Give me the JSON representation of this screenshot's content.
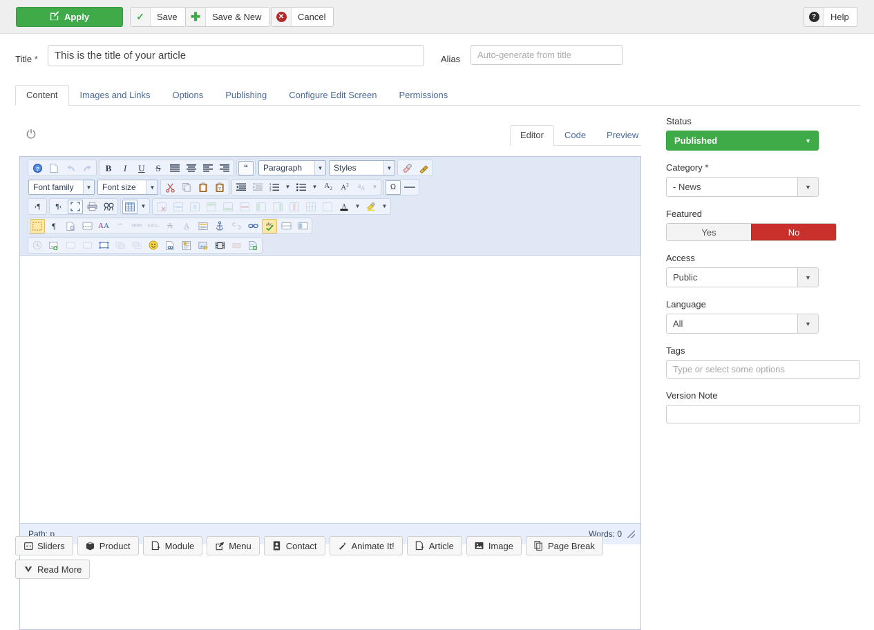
{
  "toolbar": {
    "apply_label": "Apply",
    "apply_icon": "edit-square-icon",
    "save_label": "Save",
    "save_icon": "check-icon",
    "save_new_label": "Save & New",
    "save_new_icon": "plus-icon",
    "cancel_label": "Cancel",
    "cancel_icon": "circle-x-icon",
    "help_label": "Help",
    "help_icon": "circle-question-icon"
  },
  "form": {
    "title_label": "Title",
    "title_required": "*",
    "title_value": "This is the title of your article",
    "alias_label": "Alias",
    "alias_value": "",
    "alias_placeholder": "Auto-generate from title"
  },
  "tabs": [
    {
      "label": "Content",
      "active": true
    },
    {
      "label": "Images and Links",
      "active": false
    },
    {
      "label": "Options",
      "active": false
    },
    {
      "label": "Publishing",
      "active": false
    },
    {
      "label": "Configure Edit Screen",
      "active": false
    },
    {
      "label": "Permissions",
      "active": false
    }
  ],
  "editor": {
    "toggle_icon": "power-icon",
    "view_tabs": [
      {
        "label": "Editor",
        "active": true
      },
      {
        "label": "Code",
        "active": false
      },
      {
        "label": "Preview",
        "active": false
      }
    ],
    "content": "",
    "status_path_label": "Path:",
    "status_path_value": "p",
    "status_words_label": "Words:",
    "status_words_value": "0",
    "selects": {
      "paragraph": "Paragraph",
      "styles": "Styles",
      "font_family": "Font family",
      "font_size": "Font size"
    },
    "row1_icons": [
      "help-icon",
      "new-document-icon",
      "undo-icon",
      "redo-icon",
      "bold-icon",
      "italic-icon",
      "underline-icon",
      "strikethrough-icon",
      "align-justify-icon",
      "align-center-icon",
      "align-left-icon",
      "align-right-icon",
      "blockquote-icon",
      "eraser-icon",
      "cleanup-icon"
    ],
    "row2_icons": [
      "cut-icon",
      "copy-icon",
      "paste-icon",
      "paste-text-icon",
      "outdent-icon",
      "indent-icon",
      "numbered-list-icon",
      "numbered-list-dropdown-icon",
      "bullet-list-icon",
      "bullet-list-dropdown-icon",
      "subscript-icon",
      "superscript-icon",
      "remove-format-icon",
      "special-character-icon",
      "horizontal-rule-icon"
    ],
    "row3_icons": [
      "ltr-icon",
      "rtl-icon",
      "fullscreen-icon",
      "print-icon",
      "search-replace-icon",
      "table-icon",
      "table-dropdown-icon",
      "delete-table-icon",
      "row-properties-icon",
      "cell-properties-icon",
      "insert-row-before-icon",
      "insert-row-after-icon",
      "delete-row-icon",
      "insert-col-before-icon",
      "insert-col-after-icon",
      "delete-col-icon",
      "split-cells-icon",
      "merge-cells-icon",
      "forecolor-icon",
      "forecolor-dropdown-icon",
      "backcolor-icon",
      "backcolor-dropdown-icon"
    ],
    "row4_icons": [
      "visual-blocks-icon",
      "show-invisible-icon",
      "page-properties-icon",
      "insert-pagebreak-icon",
      "font-select-icon",
      "quotation-icon",
      "abbreviation-icon",
      "acronym-icon",
      "delete-text-icon",
      "insert-text-icon",
      "template-icon",
      "anchor-icon",
      "unlink-icon",
      "link-icon",
      "spellcheck-icon",
      "insert-layer-icon",
      "insert-iframe-icon"
    ],
    "row5_icons": [
      "insert-date-icon",
      "insert-image-icon",
      "layer-box-icon",
      "layer-move-icon",
      "absolute-position-icon",
      "move-forward-icon",
      "move-backward-icon",
      "emoticon-icon",
      "insert-link-doc-icon",
      "insert-media-icon",
      "insert-picture-icon",
      "insert-video-icon",
      "insert-flash-icon",
      "insert-file-icon"
    ]
  },
  "editor_buttons": [
    {
      "label": "Sliders",
      "icon": "sliders-icon"
    },
    {
      "label": "Product",
      "icon": "box-icon"
    },
    {
      "label": "Module",
      "icon": "module-icon"
    },
    {
      "label": "Menu",
      "icon": "share-icon"
    },
    {
      "label": "Contact",
      "icon": "contact-card-icon"
    },
    {
      "label": "Animate It!",
      "icon": "magic-wand-icon"
    },
    {
      "label": "Article",
      "icon": "article-icon"
    },
    {
      "label": "Image",
      "icon": "image-icon"
    },
    {
      "label": "Page Break",
      "icon": "page-break-icon"
    },
    {
      "label": "Read More",
      "icon": "chevron-down-icon"
    }
  ],
  "sidebar": {
    "status_label": "Status",
    "status_value": "Published",
    "category_label": "Category",
    "category_required": "*",
    "category_value": "- News",
    "featured_label": "Featured",
    "featured_yes": "Yes",
    "featured_no": "No",
    "featured_selected": "No",
    "access_label": "Access",
    "access_value": "Public",
    "language_label": "Language",
    "language_value": "All",
    "tags_label": "Tags",
    "tags_value": "",
    "tags_placeholder": "Type or select some options",
    "version_note_label": "Version Note",
    "version_note_value": ""
  },
  "colors": {
    "accent_green": "#3eab48",
    "danger_red": "#c9302c",
    "toolbar_bg": "#efefef",
    "link_blue": "#4a6a96",
    "mce_bg": "#e0e8f6"
  }
}
